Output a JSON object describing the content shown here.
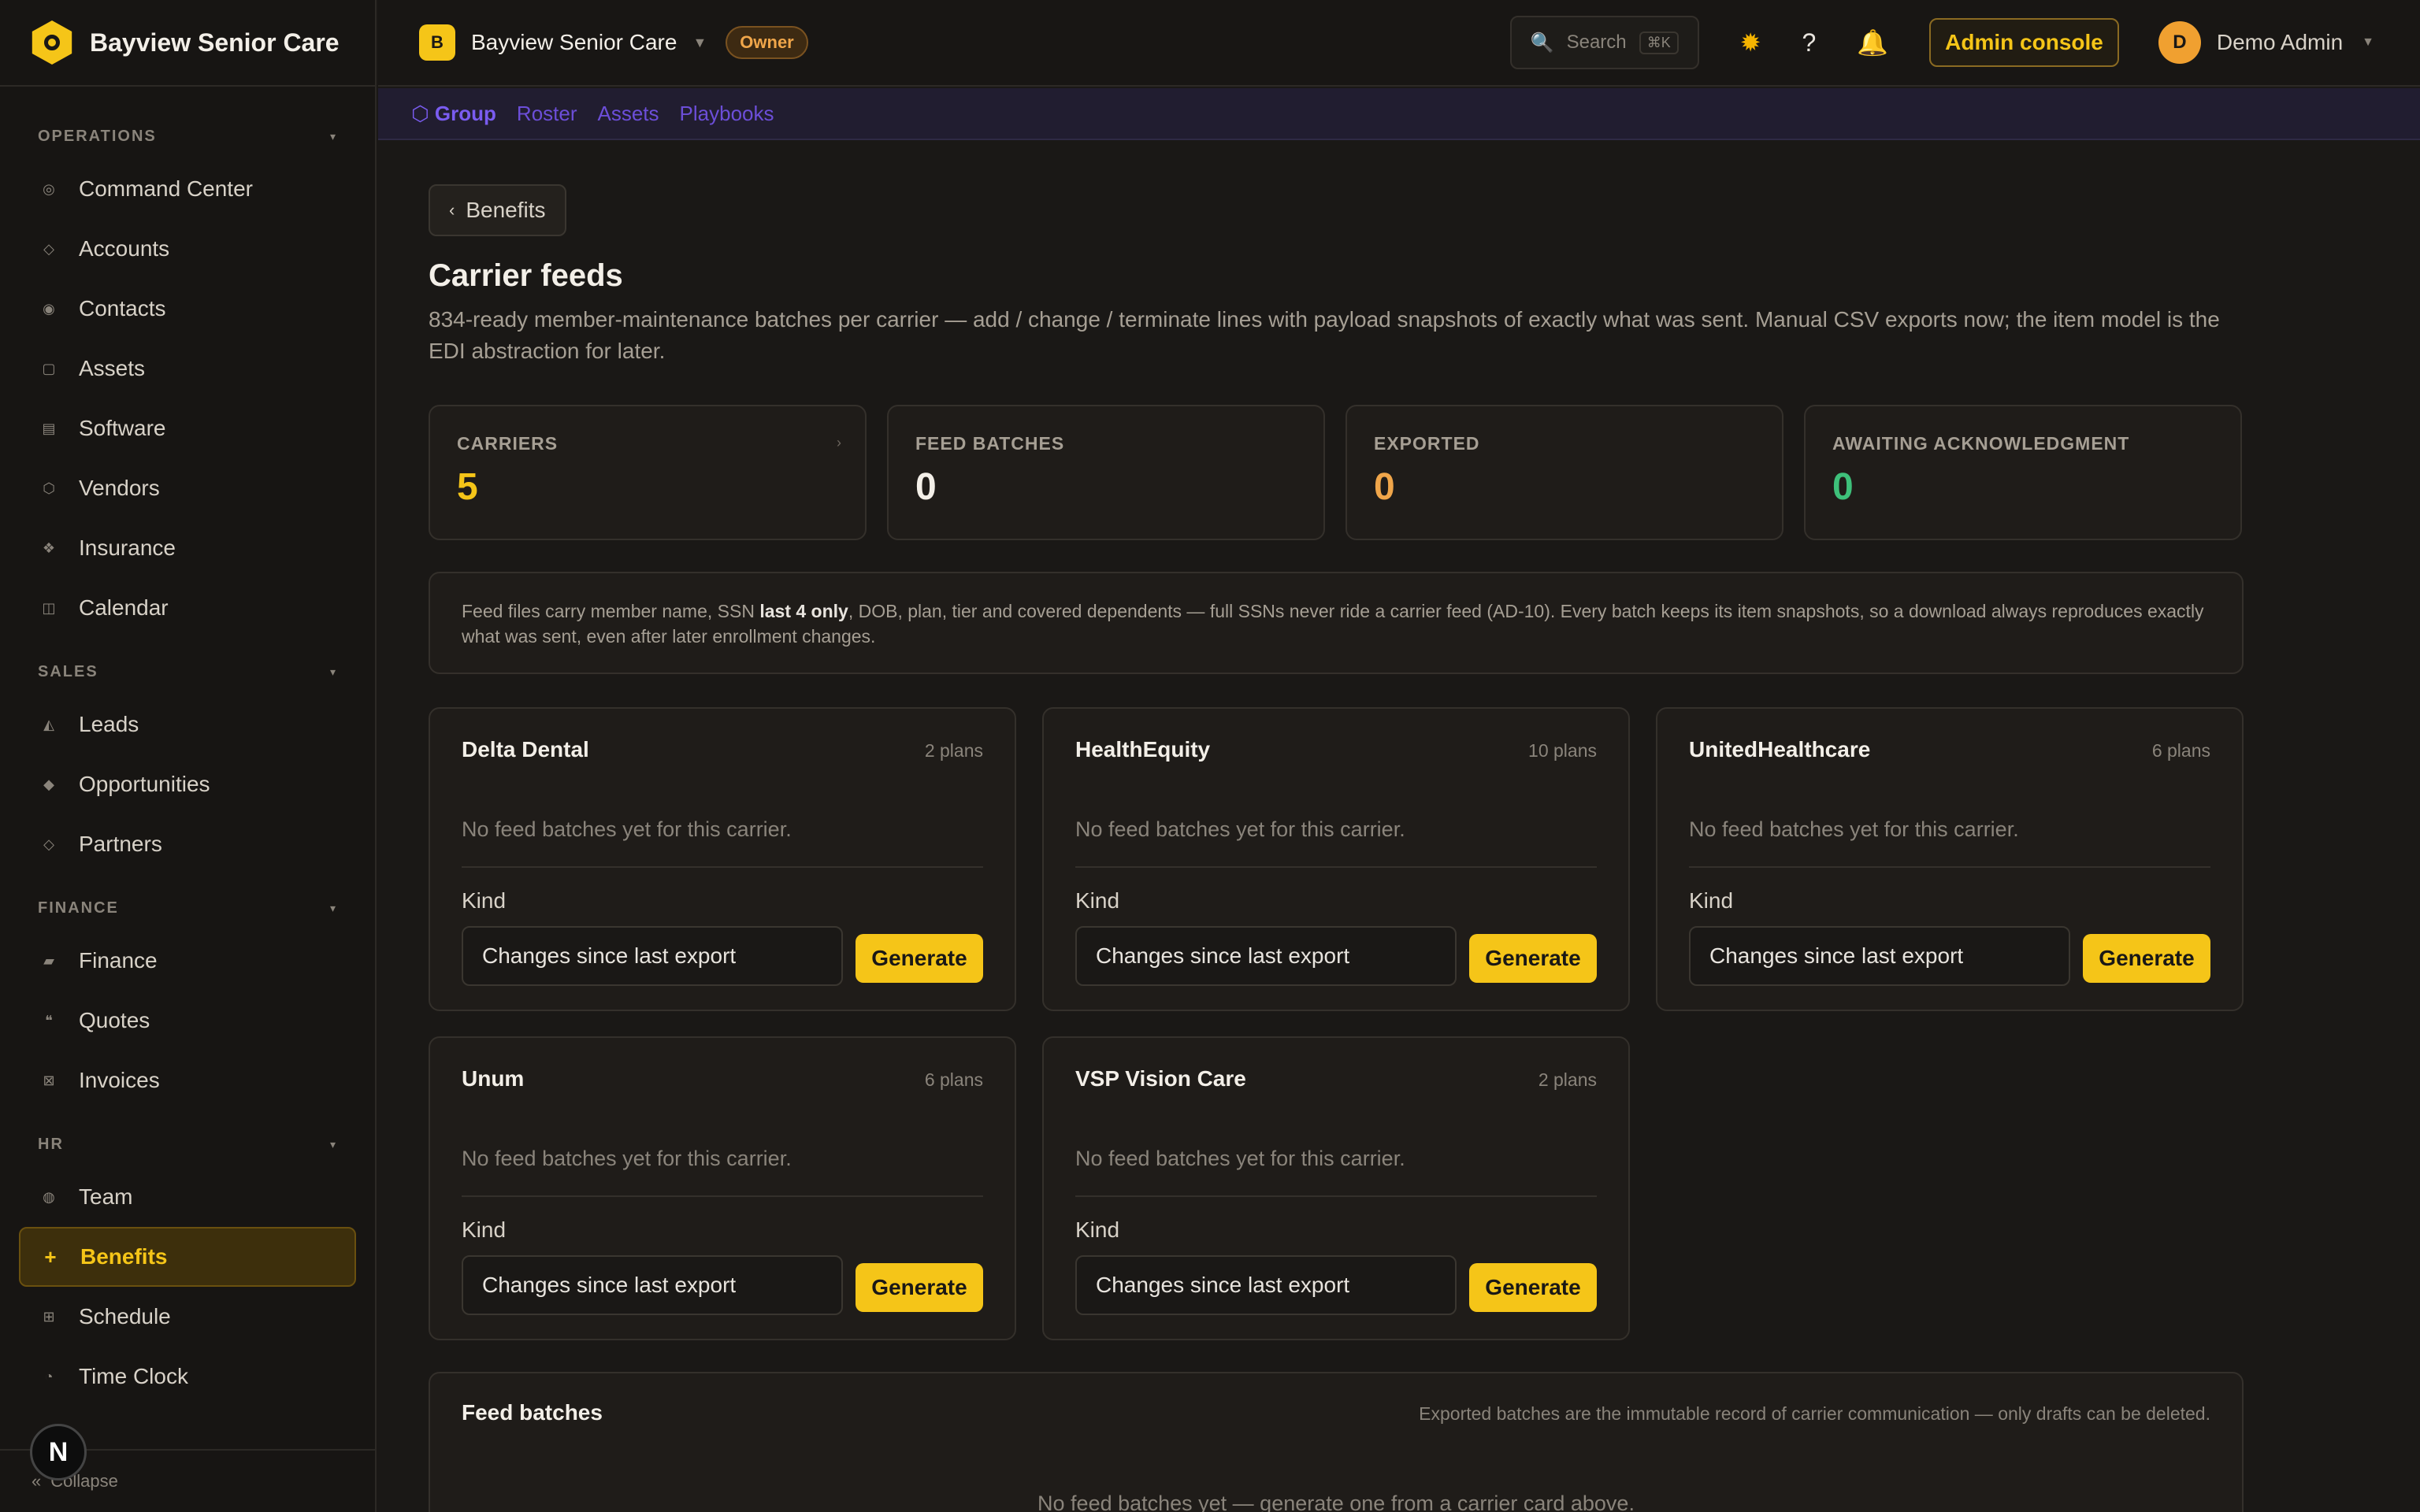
{
  "brand": {
    "name": "Bayview Senior Care"
  },
  "sidebar": {
    "sections": [
      {
        "title": "OPERATIONS",
        "items": [
          {
            "label": "Command Center",
            "icon": "target-icon",
            "glyph": "◎"
          },
          {
            "label": "Accounts",
            "icon": "diamond-icon",
            "glyph": "◇"
          },
          {
            "label": "Contacts",
            "icon": "dot-circle-icon",
            "glyph": "◉"
          },
          {
            "label": "Assets",
            "icon": "square-icon",
            "glyph": "▢"
          },
          {
            "label": "Software",
            "icon": "list-icon",
            "glyph": "▤"
          },
          {
            "label": "Vendors",
            "icon": "hexagon-icon",
            "glyph": "⬡"
          },
          {
            "label": "Insurance",
            "icon": "shield-icon",
            "glyph": "❖"
          },
          {
            "label": "Calendar",
            "icon": "calendar-icon",
            "glyph": "◫"
          }
        ]
      },
      {
        "title": "SALES",
        "items": [
          {
            "label": "Leads",
            "icon": "triangle-icon",
            "glyph": "◭"
          },
          {
            "label": "Opportunities",
            "icon": "diamond-filled-icon",
            "glyph": "◆"
          },
          {
            "label": "Partners",
            "icon": "diamond-icon",
            "glyph": "◇"
          }
        ]
      },
      {
        "title": "FINANCE",
        "items": [
          {
            "label": "Finance",
            "icon": "wallet-icon",
            "glyph": "▰"
          },
          {
            "label": "Quotes",
            "icon": "quote-icon",
            "glyph": "❝"
          },
          {
            "label": "Invoices",
            "icon": "invoice-icon",
            "glyph": "⊠"
          }
        ]
      },
      {
        "title": "HR",
        "items": [
          {
            "label": "Team",
            "icon": "team-icon",
            "glyph": "◍"
          },
          {
            "label": "Benefits",
            "icon": "plus-icon",
            "glyph": "+",
            "active": true
          },
          {
            "label": "Schedule",
            "icon": "grid-icon",
            "glyph": "⊞"
          },
          {
            "label": "Time Clock",
            "icon": "clock-icon",
            "glyph": "◔"
          }
        ]
      }
    ],
    "collapse_label": "Collapse",
    "n_badge": "N"
  },
  "topbar": {
    "org_initial": "B",
    "org_name": "Bayview Senior Care",
    "role": "Owner",
    "search_placeholder": "Search",
    "search_shortcut": "⌘K",
    "admin_label": "Admin console",
    "user_initial": "D",
    "user_name": "Demo Admin"
  },
  "subnav": {
    "items": [
      "⬡ Group",
      "Roster",
      "Assets",
      "Playbooks"
    ]
  },
  "page": {
    "back_label": "Benefits",
    "title": "Carrier feeds",
    "description": "834-ready member-maintenance batches per carrier — add / change / terminate lines with payload snapshots of exactly what was sent. Manual CSV exports now; the item model is the EDI abstraction for later."
  },
  "stats": [
    {
      "label": "CARRIERS",
      "value": "5",
      "color": "#f5c518",
      "arrow": true
    },
    {
      "label": "FEED BATCHES",
      "value": "0",
      "color": "#f3efe8"
    },
    {
      "label": "EXPORTED",
      "value": "0",
      "color": "#f0a64a"
    },
    {
      "label": "AWAITING ACKNOWLEDGMENT",
      "value": "0",
      "color": "#3ec07a"
    }
  ],
  "notice": {
    "before": "Feed files carry member name, SSN ",
    "bold": "last 4 only",
    "after": ", DOB, plan, tier and covered dependents — full SSNs never ride a carrier feed (AD-10). Every batch keeps its item snapshots, so a download always reproduces exactly what was sent, even after later enrollment changes."
  },
  "carriers": [
    {
      "name": "Delta Dental",
      "plans": "2 plans"
    },
    {
      "name": "HealthEquity",
      "plans": "10 plans"
    },
    {
      "name": "UnitedHealthcare",
      "plans": "6 plans"
    },
    {
      "name": "Unum",
      "plans": "6 plans"
    },
    {
      "name": "VSP Vision Care",
      "plans": "2 plans"
    }
  ],
  "carrier_card": {
    "empty_text": "No feed batches yet for this carrier.",
    "kind_label": "Kind",
    "kind_value": "Changes since last export",
    "generate_label": "Generate"
  },
  "batches": {
    "title": "Feed batches",
    "hint": "Exported batches are the immutable record of carrier communication — only drafts can be deleted.",
    "empty_text": "No feed batches yet — generate one from a carrier card above."
  }
}
